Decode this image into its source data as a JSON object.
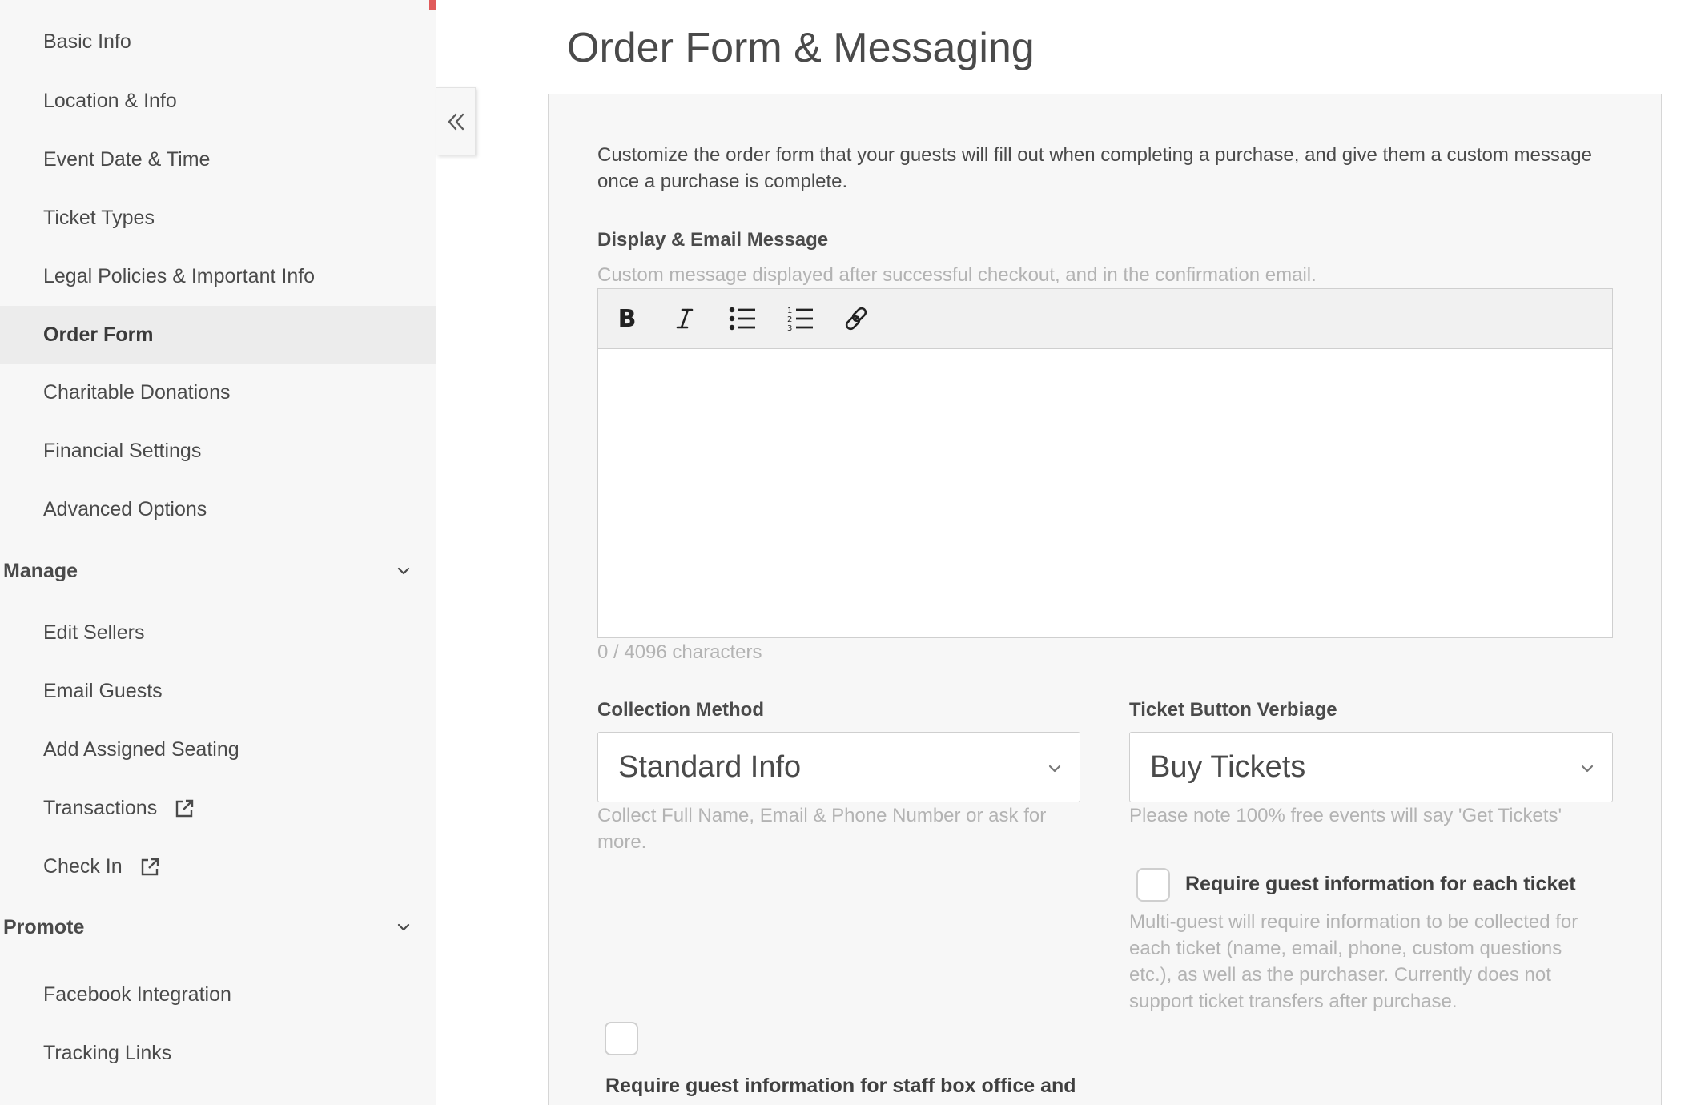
{
  "sidebar": {
    "items": [
      {
        "label": "Basic Info"
      },
      {
        "label": "Location & Info"
      },
      {
        "label": "Event Date & Time"
      },
      {
        "label": "Ticket Types"
      },
      {
        "label": "Legal Policies & Important Info"
      },
      {
        "label": "Order Form"
      },
      {
        "label": "Charitable Donations"
      },
      {
        "label": "Financial Settings"
      },
      {
        "label": "Advanced Options"
      }
    ],
    "active_item": "Order Form",
    "manage": {
      "title": "Manage",
      "items": [
        {
          "label": "Edit Sellers"
        },
        {
          "label": "Email Guests"
        },
        {
          "label": "Add Assigned Seating"
        },
        {
          "label": "Transactions",
          "icon": "external-link-icon"
        },
        {
          "label": "Check In",
          "icon": "external-link-icon"
        }
      ]
    },
    "promote": {
      "title": "Promote",
      "items": [
        {
          "label": "Facebook Integration"
        },
        {
          "label": "Tracking Links"
        }
      ]
    },
    "collapse_icon": "double-chevron-left-icon"
  },
  "main": {
    "title": "Order Form & Messaging",
    "intro": "Customize the order form that your guests will fill out when completing a purchase, and give them a custom message once a purchase is complete.",
    "display_message": {
      "label": "Display & Email Message",
      "help": "Custom message displayed after successful checkout, and in the confirmation email.",
      "toolbar": [
        "bold-icon",
        "italic-icon",
        "bulleted-list-icon",
        "numbered-list-icon",
        "link-icon"
      ],
      "value": "",
      "char_count": "0 / 4096 characters"
    },
    "collection_method": {
      "label": "Collection Method",
      "value": "Standard Info",
      "help": "Collect Full Name, Email & Phone Number or ask for more."
    },
    "ticket_button": {
      "label": "Ticket Button Verbiage",
      "value": "Buy Tickets",
      "help": "Please note 100% free events will say 'Get Tickets'"
    },
    "require_each_ticket": {
      "label": "Require guest information for each ticket",
      "checked": false,
      "help": "Multi-guest will require information to be collected for each ticket (name, email, phone, custom questions etc.), as well as the purchaser. Currently does not support ticket transfers after purchase."
    },
    "require_staff": {
      "label": "Require guest information for staff box office and",
      "checked": false
    }
  },
  "colors": {
    "accent": "#e05a5a",
    "sidebar_bg": "#f7f7f7",
    "active_bg": "#ececec",
    "help_text": "#b3b3b3"
  }
}
